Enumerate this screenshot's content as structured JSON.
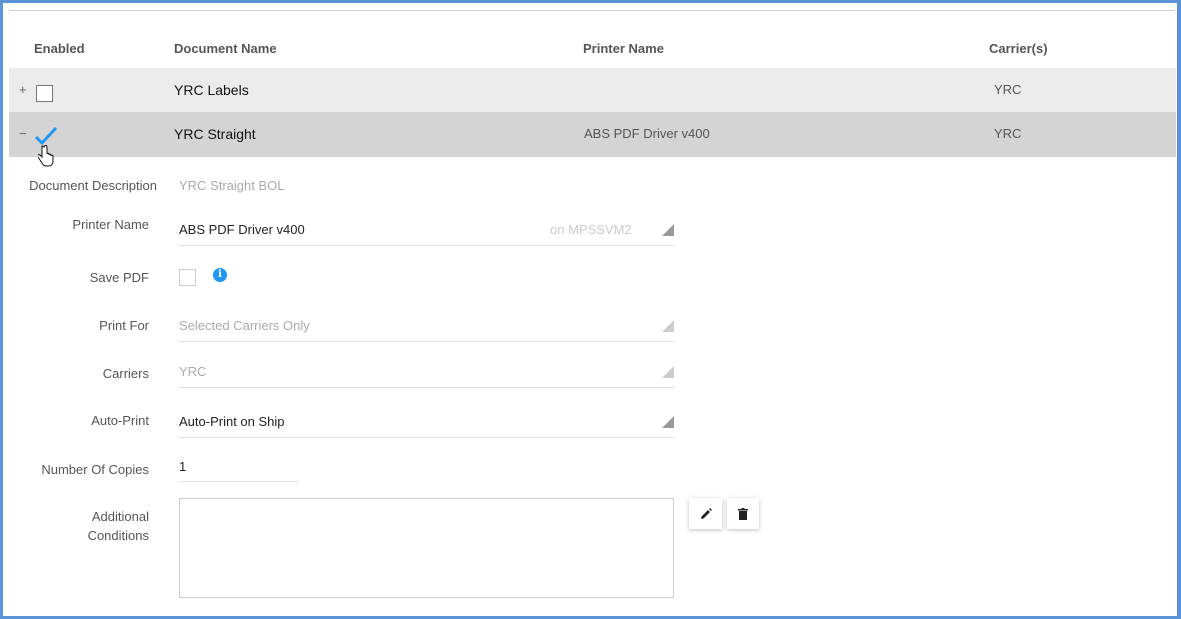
{
  "table": {
    "headers": {
      "enabled": "Enabled",
      "document_name": "Document Name",
      "printer_name": "Printer Name",
      "carriers": "Carrier(s)"
    },
    "rows": [
      {
        "expander": "+",
        "enabled": false,
        "document_name": "YRC Labels",
        "printer_name": "",
        "carriers": "YRC"
      },
      {
        "expander": "−",
        "enabled": true,
        "document_name": "YRC Straight",
        "printer_name": "ABS PDF Driver v400",
        "carriers": "YRC"
      }
    ]
  },
  "detail": {
    "document_description": {
      "label": "Document Description",
      "value": "YRC Straight BOL"
    },
    "printer_name": {
      "label": "Printer Name",
      "value": "ABS PDF Driver v400",
      "suffix": "on MPSSVM2"
    },
    "save_pdf": {
      "label": "Save PDF",
      "checked": false
    },
    "print_for": {
      "label": "Print For",
      "value": "Selected Carriers Only"
    },
    "carriers": {
      "label": "Carriers",
      "value": "YRC"
    },
    "auto_print": {
      "label": "Auto-Print",
      "value": "Auto-Print on Ship"
    },
    "number_of_copies": {
      "label": "Number Of Copies",
      "value": "1"
    },
    "additional_conditions": {
      "label_line1": "Additional",
      "label_line2": "Conditions",
      "value": ""
    }
  },
  "colors": {
    "accent": "#2196f3",
    "frame": "#5b93d9"
  }
}
